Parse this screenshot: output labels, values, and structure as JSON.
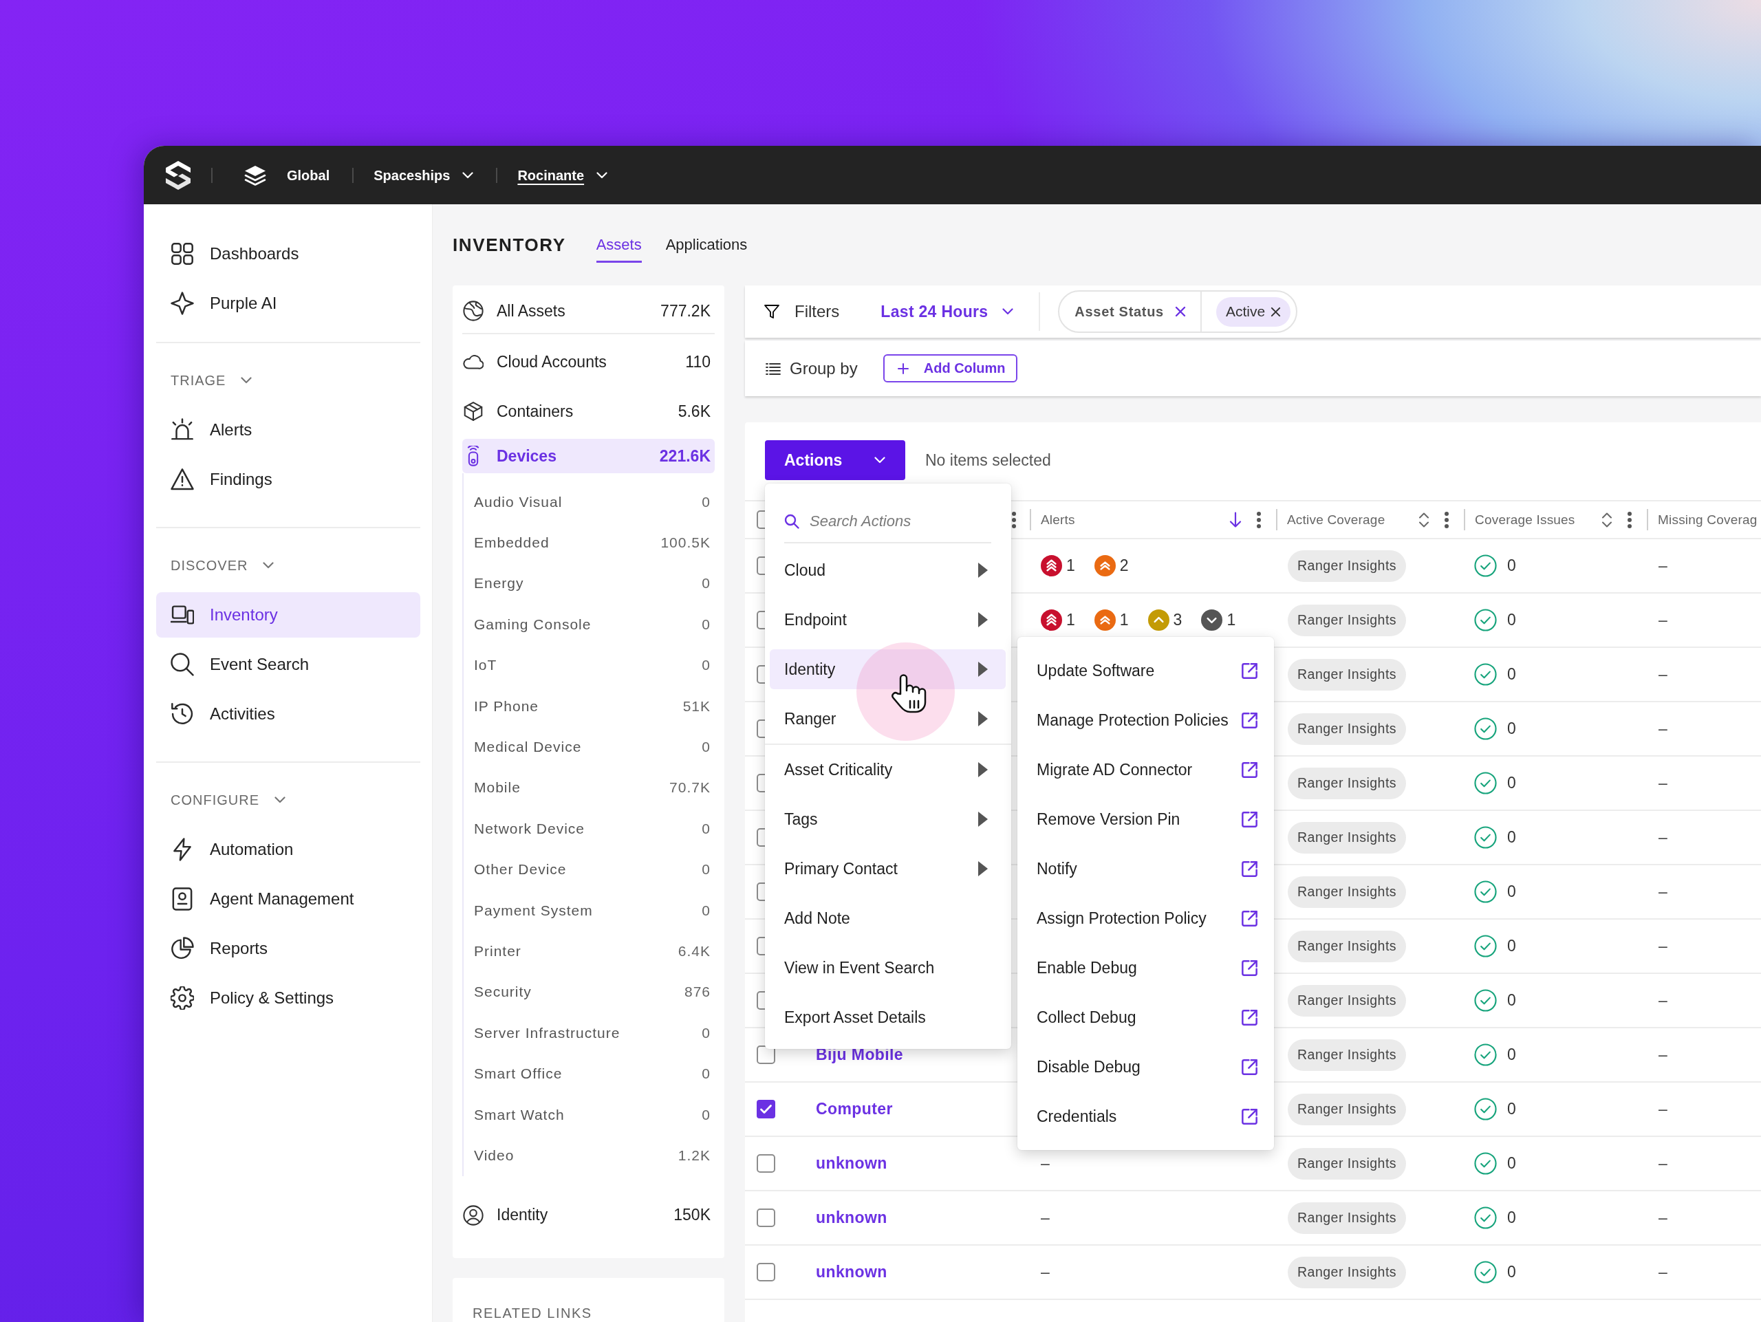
{
  "top_bar": {
    "breadcrumbs": [
      {
        "label": "Global",
        "selected": false,
        "dropdown": false
      },
      {
        "label": "Spaceships",
        "selected": false,
        "dropdown": true
      },
      {
        "label": "Rocinante",
        "selected": true,
        "dropdown": true
      }
    ]
  },
  "sidebar": {
    "sections": [
      {
        "items": [
          {
            "label": "Dashboards",
            "selected": false
          },
          {
            "label": "Purple AI",
            "selected": false
          }
        ]
      },
      {
        "title": "TRIAGE",
        "expanded": true,
        "items": [
          {
            "label": "Alerts",
            "selected": false
          },
          {
            "label": "Findings",
            "selected": false
          }
        ]
      },
      {
        "title": "DISCOVER",
        "expanded": true,
        "items": [
          {
            "label": "Inventory",
            "selected": true
          },
          {
            "label": "Event Search",
            "selected": false
          },
          {
            "label": "Activities",
            "selected": false
          }
        ]
      },
      {
        "title": "CONFIGURE",
        "expanded": true,
        "items": [
          {
            "label": "Automation",
            "selected": false
          },
          {
            "label": "Agent Management",
            "selected": false
          },
          {
            "label": "Reports",
            "selected": false
          },
          {
            "label": "Policy & Settings",
            "selected": false
          }
        ]
      }
    ]
  },
  "page": {
    "title": "INVENTORY",
    "tabs": [
      {
        "label": "Assets",
        "selected": true
      },
      {
        "label": "Applications",
        "selected": false
      }
    ]
  },
  "asset_types": {
    "items": [
      {
        "label": "All Assets",
        "count": "777.2K",
        "selected": false
      },
      {
        "label": "Cloud Accounts",
        "count": "110",
        "selected": false
      },
      {
        "label": "Containers",
        "count": "5.6K",
        "selected": false
      },
      {
        "label": "Devices",
        "count": "221.6K",
        "selected": true,
        "children": [
          {
            "label": "Audio Visual",
            "count": "0",
            "selected": false
          },
          {
            "label": "Embedded",
            "count": "100.5K",
            "selected": false
          },
          {
            "label": "Energy",
            "count": "0",
            "selected": false
          },
          {
            "label": "Gaming Console",
            "count": "0",
            "selected": false
          },
          {
            "label": "IoT",
            "count": "0",
            "selected": false
          },
          {
            "label": "IP Phone",
            "count": "51K",
            "selected": false
          },
          {
            "label": "Medical Device",
            "count": "0",
            "selected": false
          },
          {
            "label": "Mobile",
            "count": "70.7K",
            "selected": false
          },
          {
            "label": "Network Device",
            "count": "0",
            "selected": false
          },
          {
            "label": "Other Device",
            "count": "0",
            "selected": false
          },
          {
            "label": "Payment System",
            "count": "0",
            "selected": false
          },
          {
            "label": "Printer",
            "count": "6.4K",
            "selected": false
          },
          {
            "label": "Security",
            "count": "876",
            "selected": false
          },
          {
            "label": "Server Infrastructure",
            "count": "0",
            "selected": false
          },
          {
            "label": "Smart Office",
            "count": "0",
            "selected": false
          },
          {
            "label": "Smart Watch",
            "count": "0",
            "selected": false
          },
          {
            "label": "Video",
            "count": "1.2K",
            "selected": false
          }
        ]
      },
      {
        "label": "Identity",
        "count": "150K",
        "selected": false
      }
    ]
  },
  "related_links": {
    "title": "RELATED LINKS"
  },
  "filters": {
    "label": "Filters",
    "time_range": "Last 24 Hours",
    "active_filter": {
      "field": "Asset Status",
      "value": "Active"
    }
  },
  "group_by": {
    "label": "Group by",
    "add_column": "Add Column"
  },
  "table": {
    "actions": "Actions",
    "selection_status": "No items selected",
    "select_all": {
      "checked": false
    },
    "columns": [
      {
        "label": "Alerts",
        "sorted": true
      },
      {
        "label": "Active Coverage",
        "sorted": false
      },
      {
        "label": "Coverage Issues",
        "sorted": false
      },
      {
        "label": "Missing Coverag"
      }
    ],
    "rows": [
      {
        "checked": false,
        "alerts": [
          {
            "kind": "critical",
            "count": "1",
            "color": "#c8102e"
          },
          {
            "kind": "high",
            "count": "2",
            "color": "#ea6a12"
          }
        ],
        "coverage": "Ranger Insights",
        "issues": "0",
        "missing": "–"
      },
      {
        "checked": false,
        "alerts": [
          {
            "kind": "critical",
            "count": "1",
            "color": "#c8102e"
          },
          {
            "kind": "high",
            "count": "1",
            "color": "#ea6a12"
          },
          {
            "kind": "medium",
            "count": "3",
            "color": "#c39b06"
          },
          {
            "kind": "low",
            "count": "1",
            "color": "#555555"
          }
        ],
        "coverage": "Ranger Insights",
        "issues": "0",
        "missing": "–"
      },
      {
        "checked": false,
        "coverage": "Ranger Insights",
        "issues": "0",
        "missing": "–"
      },
      {
        "checked": false,
        "coverage": "Ranger Insights",
        "issues": "0",
        "missing": "–"
      },
      {
        "checked": false,
        "coverage": "Ranger Insights",
        "issues": "0",
        "missing": "–"
      },
      {
        "checked": false,
        "coverage": "Ranger Insights",
        "issues": "0",
        "missing": "–"
      },
      {
        "checked": false,
        "coverage": "Ranger Insights",
        "issues": "0",
        "missing": "–"
      },
      {
        "checked": false,
        "coverage": "Ranger Insights",
        "issues": "0",
        "missing": "–"
      },
      {
        "checked": false,
        "coverage": "Ranger Insights",
        "issues": "0",
        "missing": "–"
      },
      {
        "checked": false,
        "name": "Biju Mobile",
        "coverage": "Ranger Insights",
        "issues": "0",
        "missing": "–"
      },
      {
        "checked": true,
        "name": "Computer",
        "coverage": "Ranger Insights",
        "issues": "0",
        "missing": "–"
      },
      {
        "checked": false,
        "name": "unknown",
        "alerts": "–",
        "coverage": "Ranger Insights",
        "issues": "0",
        "missing": "–"
      },
      {
        "checked": false,
        "name": "unknown",
        "alerts": "–",
        "coverage": "Ranger Insights",
        "issues": "0",
        "missing": "–"
      },
      {
        "checked": false,
        "name": "unknown",
        "alerts": "–",
        "coverage": "Ranger Insights",
        "issues": "0",
        "missing": "–"
      }
    ]
  },
  "actions_menu": {
    "search": {
      "placeholder": "Search Actions"
    },
    "groups": [
      {
        "items": [
          {
            "label": "Cloud",
            "submenu": true,
            "selected": false
          },
          {
            "label": "Endpoint",
            "submenu": true,
            "selected": false
          },
          {
            "label": "Identity",
            "submenu": true,
            "selected": true
          },
          {
            "label": "Ranger",
            "submenu": true,
            "selected": false
          }
        ]
      },
      {
        "items": [
          {
            "label": "Asset Criticality",
            "submenu": true,
            "selected": false
          },
          {
            "label": "Tags",
            "submenu": true,
            "selected": false
          },
          {
            "label": "Primary Contact",
            "submenu": true,
            "selected": false
          },
          {
            "label": "Add Note",
            "submenu": false,
            "selected": false
          },
          {
            "label": "View in Event Search",
            "submenu": false,
            "selected": false
          },
          {
            "label": "Export Asset Details",
            "submenu": false,
            "selected": false
          }
        ]
      }
    ]
  },
  "identity_submenu": {
    "items": [
      {
        "label": "Update Software",
        "external": true
      },
      {
        "label": "Manage Protection Policies",
        "external": true
      },
      {
        "label": "Migrate AD Connector",
        "external": true
      },
      {
        "label": "Remove Version Pin",
        "external": true
      },
      {
        "label": "Notify",
        "external": true
      },
      {
        "label": "Assign Protection Policy",
        "external": true
      },
      {
        "label": "Enable Debug",
        "external": true
      },
      {
        "label": "Collect Debug",
        "external": true
      },
      {
        "label": "Disable Debug",
        "external": true
      },
      {
        "label": "Credentials",
        "external": true
      }
    ]
  }
}
